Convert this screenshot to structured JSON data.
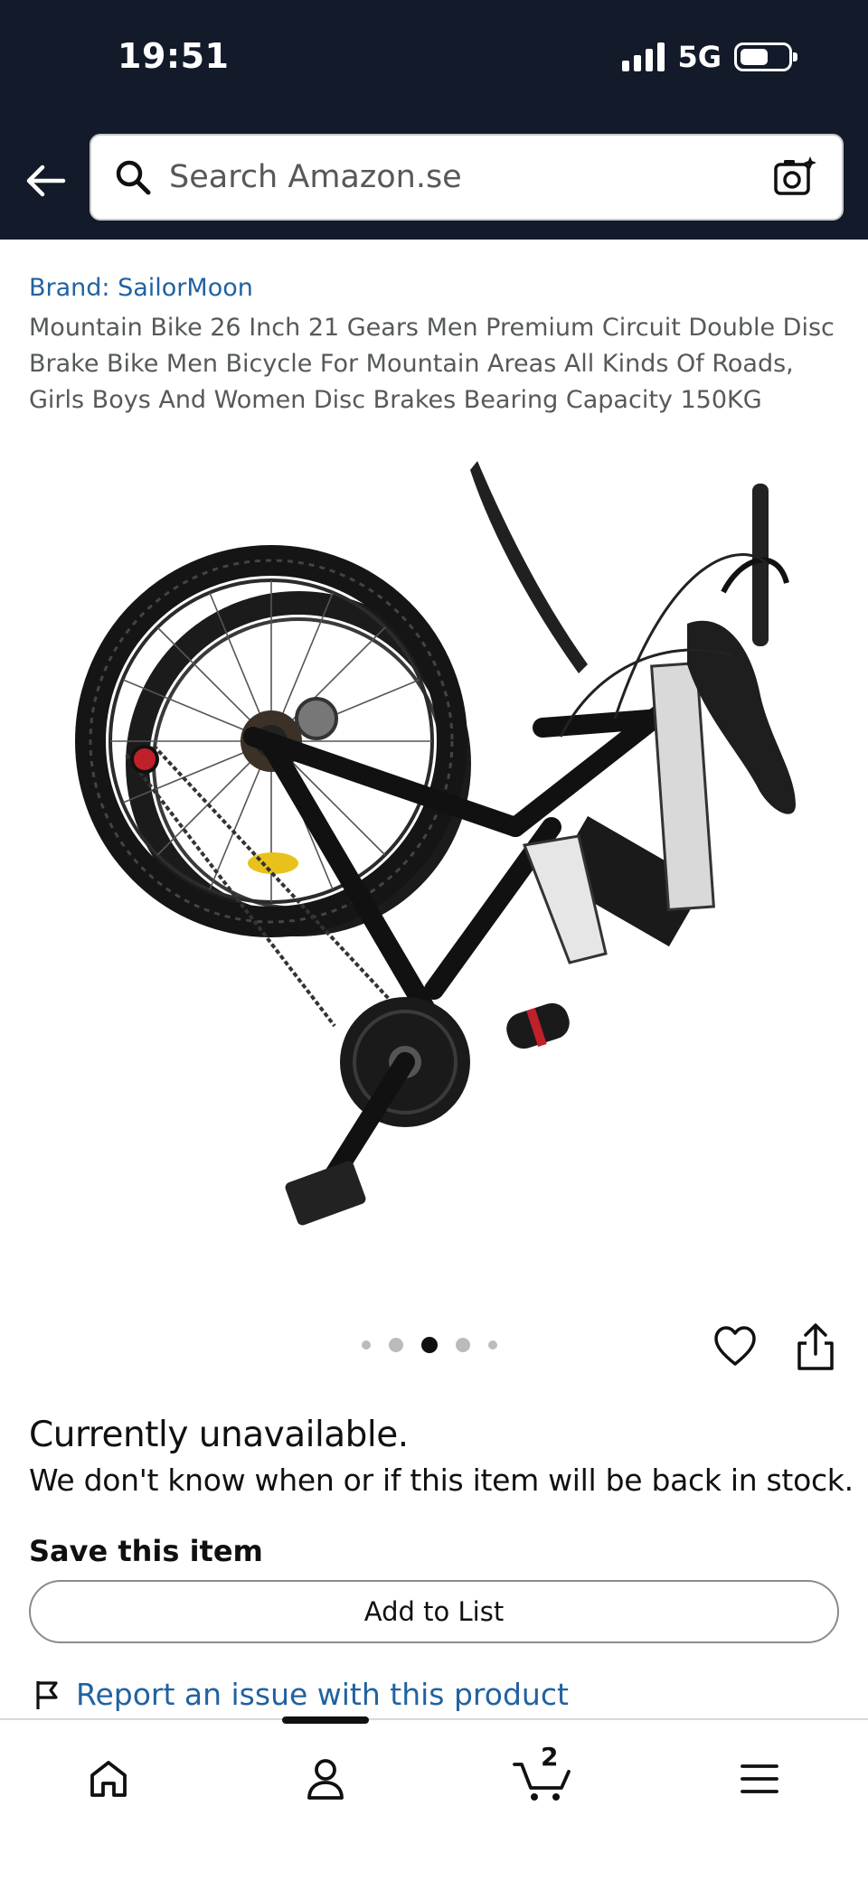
{
  "status_bar": {
    "time": "19:51",
    "network": "5G"
  },
  "search": {
    "placeholder": "Search Amazon.se"
  },
  "product": {
    "brand": "Brand: SailorMoon",
    "title": "Mountain Bike 26 Inch 21 Gears Men Premium Circuit Double Disc Brake Bike Men Bicycle For Mountain Areas All Kinds Of Roads, Girls Boys And Women Disc Brakes Bearing Capacity 150KG",
    "image_count": 5,
    "active_image": 3
  },
  "availability": {
    "heading": "Currently unavailable.",
    "message": "We don't know when or if this item will be back in stock."
  },
  "save": {
    "label": "Save this item",
    "button": "Add to List"
  },
  "report": {
    "label": "Report an issue with this product"
  },
  "bottom_nav": {
    "items": [
      "home-icon",
      "account-icon",
      "cart-icon",
      "menu-icon"
    ],
    "cart_count": "2"
  },
  "colors": {
    "header_bg": "#131a29",
    "link": "#2162a1",
    "text": "#0f1111",
    "muted": "#565959"
  }
}
